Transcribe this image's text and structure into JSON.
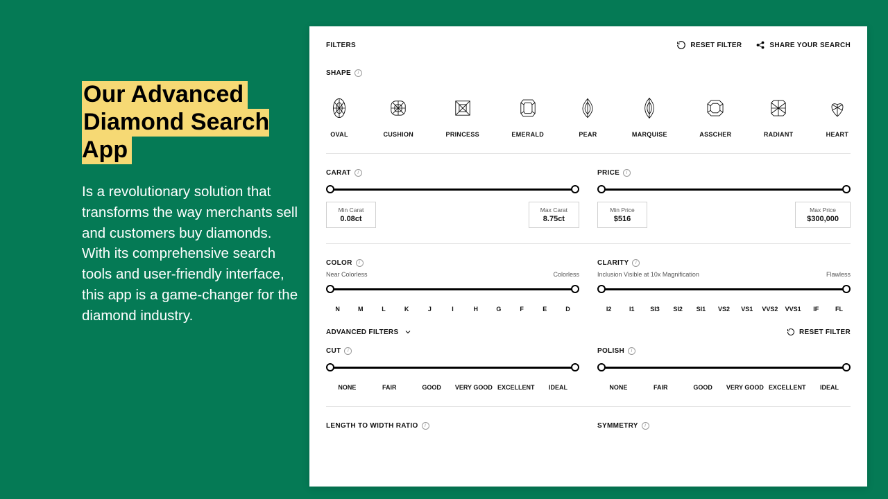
{
  "promo": {
    "title_line1": "Our Advanced",
    "title_line2": "Diamond Search App",
    "body": "Is a revolutionary solution that transforms the way merchants sell and customers buy diamonds. With its comprehensive search tools and user-friendly interface, this app is a game-changer for the diamond industry."
  },
  "topbar": {
    "filters": "FILTERS",
    "reset": "RESET FILTER",
    "share": "SHARE YOUR SEARCH"
  },
  "shape": {
    "label": "SHAPE",
    "items": [
      "OVAL",
      "CUSHION",
      "PRINCESS",
      "EMERALD",
      "PEAR",
      "MARQUISE",
      "ASSCHER",
      "RADIANT",
      "HEART"
    ]
  },
  "carat": {
    "label": "CARAT",
    "min_label": "Min Carat",
    "min_value": "0.08ct",
    "max_label": "Max Carat",
    "max_value": "8.75ct"
  },
  "price": {
    "label": "PRICE",
    "min_label": "Min Price",
    "min_value": "$516",
    "max_label": "Max Price",
    "max_value": "$300,000"
  },
  "color": {
    "label": "COLOR",
    "cap_left": "Near Colorless",
    "cap_right": "Colorless",
    "ticks": [
      "N",
      "M",
      "L",
      "K",
      "J",
      "I",
      "H",
      "G",
      "F",
      "E",
      "D"
    ]
  },
  "clarity": {
    "label": "CLARITY",
    "cap_left": "Inclusion Visible at 10x Magnification",
    "cap_right": "Flawless",
    "ticks": [
      "I2",
      "I1",
      "SI3",
      "SI2",
      "SI1",
      "VS2",
      "VS1",
      "VVS2",
      "VVS1",
      "IF",
      "FL"
    ]
  },
  "adv": {
    "label": "ADVANCED FILTERS",
    "reset": "RESET FILTER"
  },
  "cut": {
    "label": "CUT",
    "ticks": [
      "NONE",
      "FAIR",
      "GOOD",
      "VERY GOOD",
      "EXCELLENT",
      "IDEAL"
    ]
  },
  "polish": {
    "label": "POLISH",
    "ticks": [
      "NONE",
      "FAIR",
      "GOOD",
      "VERY GOOD",
      "EXCELLENT",
      "IDEAL"
    ]
  },
  "lwr": {
    "label": "LENGTH TO WIDTH RATIO"
  },
  "sym": {
    "label": "SYMMETRY"
  }
}
